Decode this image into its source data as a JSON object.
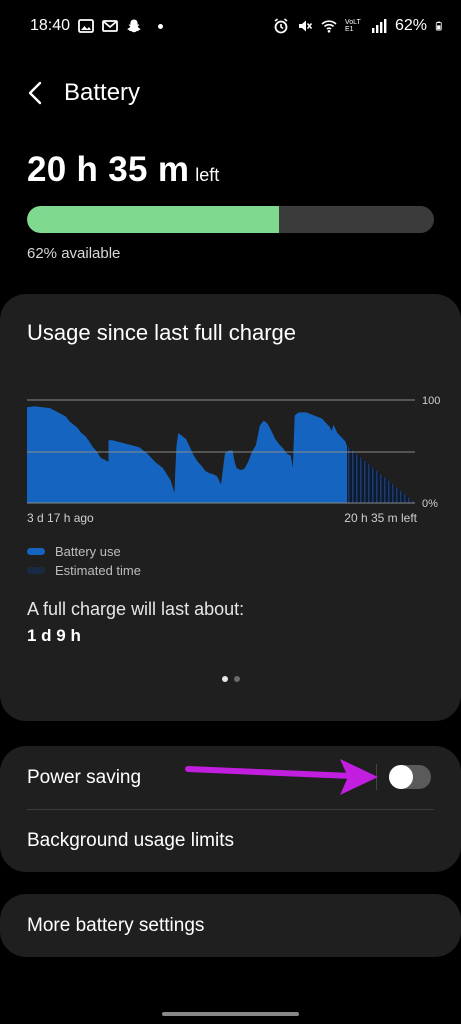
{
  "status": {
    "time": "18:40",
    "battery_pct": "62%",
    "network_label": "VoLTE1"
  },
  "header": {
    "title": "Battery"
  },
  "remaining": {
    "value": "20 h 35 m",
    "suffix": "left",
    "available": "62% available",
    "level": 0.62
  },
  "usage": {
    "title": "Usage since last full charge",
    "start_label": "3 d 17 h ago",
    "end_label": "20 h 35 m left",
    "y_top_label": "100",
    "y_bottom_label": "0%",
    "legend": [
      {
        "label": "Battery use",
        "color": "#1565c0"
      },
      {
        "label": "Estimated time",
        "color": "#1a2a45"
      }
    ],
    "full_charge_question": "A full charge will last about:",
    "full_charge_value": "1 d 9 h",
    "page_index": 0,
    "page_count": 2
  },
  "chart_data": {
    "type": "area",
    "title": "Usage since last full charge",
    "ylim": [
      0,
      100
    ],
    "y_tick_labels": [
      "100",
      "0%"
    ],
    "x_tick_labels": [
      "3 d 17 h ago",
      "20 h 35 m left"
    ],
    "series": [
      {
        "name": "Battery use",
        "points": [
          [
            0,
            93
          ],
          [
            0.02,
            94
          ],
          [
            0.04,
            93
          ],
          [
            0.06,
            92
          ],
          [
            0.08,
            88
          ],
          [
            0.1,
            84
          ],
          [
            0.11,
            79
          ],
          [
            0.12,
            76
          ],
          [
            0.13,
            73
          ],
          [
            0.14,
            68
          ],
          [
            0.15,
            65
          ],
          [
            0.16,
            60
          ],
          [
            0.17,
            54
          ],
          [
            0.18,
            50
          ],
          [
            0.19,
            44
          ],
          [
            0.2,
            42
          ],
          [
            0.21,
            40
          ],
          [
            0.21,
            61
          ],
          [
            0.22,
            61
          ],
          [
            0.23,
            60
          ],
          [
            0.25,
            58
          ],
          [
            0.27,
            56
          ],
          [
            0.29,
            54
          ],
          [
            0.31,
            48
          ],
          [
            0.33,
            40
          ],
          [
            0.35,
            34
          ],
          [
            0.37,
            22
          ],
          [
            0.38,
            10
          ],
          [
            0.385,
            55
          ],
          [
            0.39,
            68
          ],
          [
            0.41,
            62
          ],
          [
            0.43,
            46
          ],
          [
            0.44,
            40
          ],
          [
            0.45,
            36
          ],
          [
            0.46,
            31
          ],
          [
            0.47,
            29
          ],
          [
            0.48,
            28
          ],
          [
            0.49,
            26
          ],
          [
            0.5,
            18
          ],
          [
            0.51,
            48
          ],
          [
            0.52,
            51
          ],
          [
            0.53,
            51
          ],
          [
            0.535,
            40
          ],
          [
            0.54,
            34
          ],
          [
            0.55,
            32
          ],
          [
            0.56,
            33
          ],
          [
            0.57,
            40
          ],
          [
            0.58,
            50
          ],
          [
            0.59,
            56
          ],
          [
            0.6,
            75
          ],
          [
            0.61,
            80
          ],
          [
            0.62,
            77
          ],
          [
            0.63,
            70
          ],
          [
            0.64,
            62
          ],
          [
            0.65,
            57
          ],
          [
            0.66,
            53
          ],
          [
            0.67,
            48
          ],
          [
            0.68,
            46
          ],
          [
            0.685,
            34
          ],
          [
            0.69,
            85
          ],
          [
            0.7,
            88
          ],
          [
            0.72,
            88
          ],
          [
            0.74,
            85
          ],
          [
            0.76,
            82
          ],
          [
            0.77,
            78
          ],
          [
            0.78,
            74
          ],
          [
            0.785,
            70
          ],
          [
            0.79,
            76
          ],
          [
            0.8,
            68
          ],
          [
            0.81,
            64
          ],
          [
            0.82,
            60
          ],
          [
            0.825,
            55
          ]
        ]
      },
      {
        "name": "Estimated time",
        "points": [
          [
            0.825,
            55
          ],
          [
            1.0,
            0
          ]
        ]
      }
    ]
  },
  "options": {
    "power_saving": "Power saving",
    "power_saving_on": false,
    "background_limits": "Background usage limits",
    "more_settings": "More battery settings"
  },
  "colors": {
    "battery_fill": "#7fd98f",
    "chart_fill": "#1565c0",
    "arrow": "#c21ee0"
  }
}
